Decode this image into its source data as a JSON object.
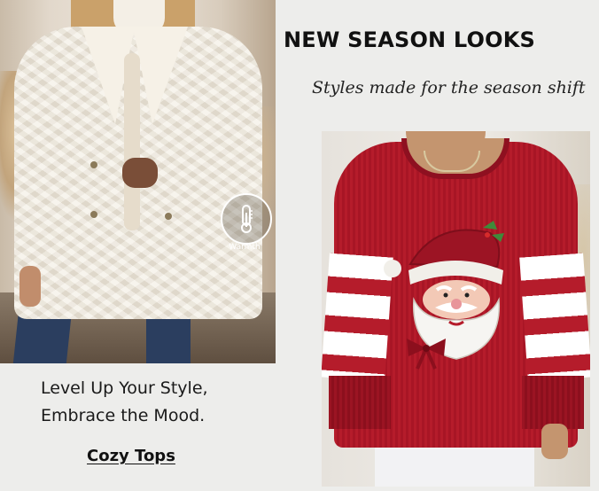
{
  "headline": "NEW SEASON LOOKS",
  "subheadline": "Styles made for the season shift",
  "left_image": {
    "alt": "",
    "badge": {
      "icon": "thermometer-icon",
      "label": "Warmth"
    }
  },
  "right_image": {
    "alt": ""
  },
  "caption": {
    "line1": "Level Up Your Style,",
    "line2": "Embrace the Mood."
  },
  "cta": {
    "label": "Cozy Tops"
  },
  "colors": {
    "background": "#ededeb",
    "sweater_red": "#b51c2b",
    "coat_cream": "#efe8da",
    "text": "#111111"
  }
}
